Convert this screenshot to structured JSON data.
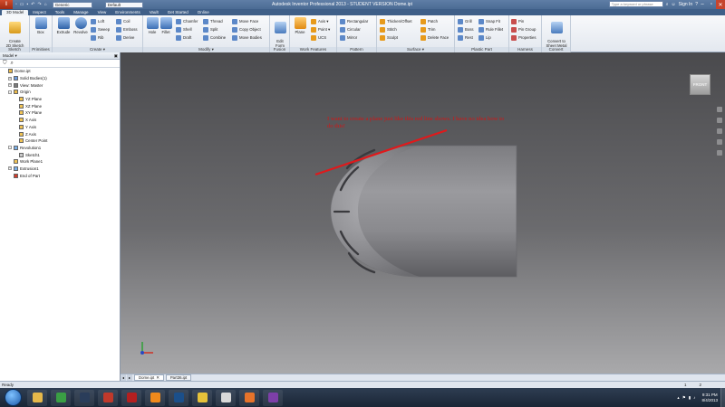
{
  "titlebar": {
    "app_menu": "I",
    "tab_label": "3D Model",
    "material_combo": "Generic",
    "appearance_combo": "Default",
    "title": "Autodesk Inventor Professional 2013 - STUDENT VERSION    Dome.ipt",
    "search_placeholder": "Type a keyword or phrase",
    "sign_in": "Sign In"
  },
  "ribbon_tabs": [
    "3D Model",
    "Inspect",
    "Tools",
    "Manage",
    "View",
    "Environments",
    "Vault",
    "Get Started",
    "Online"
  ],
  "ribbon": {
    "sketch": {
      "label": "Sketch",
      "create_2d": "Create\n2D Sketch"
    },
    "primitives": {
      "label": "Primitives",
      "box": "Box"
    },
    "create": {
      "label": "Create ▾",
      "extrude": "Extrude",
      "revolve": "Revolve",
      "loft": "Loft",
      "sweep": "Sweep",
      "rib": "Rib",
      "coil": "Coil",
      "emboss": "Emboss",
      "derive": "Derive"
    },
    "modify": {
      "label": "Modify ▾",
      "hole": "Hole",
      "fillet": "Fillet",
      "chamfer": "Chamfer",
      "shell": "Shell",
      "draft": "Draft",
      "thread": "Thread",
      "split": "Split",
      "combine": "Combine",
      "move_face": "Move Face",
      "copy_object": "Copy Object",
      "move_bodies": "Move Bodies"
    },
    "fusion": {
      "label": "Fusion",
      "edit_form": "Edit\nForm"
    },
    "work_features": {
      "label": "Work Features",
      "plane": "Plane",
      "axis": "Axis ▾",
      "point": "Point ▾",
      "ucs": "UCS"
    },
    "pattern": {
      "label": "Pattern",
      "rectangular": "Rectangular",
      "circular": "Circular",
      "mirror": "Mirror"
    },
    "surface": {
      "label": "Surface ▾",
      "thicken": "Thicken/Offset",
      "stitch": "Stitch",
      "sculpt": "Sculpt",
      "patch": "Patch",
      "trim": "Trim",
      "delete_face": "Delete Face"
    },
    "plastic_part": {
      "label": "Plastic Part",
      "grill": "Grill",
      "boss": "Boss",
      "rest": "Rest",
      "snap_fit": "Snap Fit",
      "rule_fillet": "Rule Fillet",
      "lip": "Lip"
    },
    "harness": {
      "label": "Harness",
      "pin": "Pin",
      "pin_group": "Pin Group",
      "properties": "Properties"
    },
    "convert": {
      "label": "Convert",
      "sheet_metal": "Convert to\nSheet Metal"
    }
  },
  "browser": {
    "header": "Model ▾",
    "tree": [
      {
        "label": "Dome.ipt",
        "depth": 0,
        "exp": ""
      },
      {
        "label": "Solid Bodies(1)",
        "depth": 1,
        "exp": "+"
      },
      {
        "label": "View: Master",
        "depth": 1,
        "exp": "+"
      },
      {
        "label": "Origin",
        "depth": 1,
        "exp": "-"
      },
      {
        "label": "YZ Plane",
        "depth": 2,
        "exp": ""
      },
      {
        "label": "XZ Plane",
        "depth": 2,
        "exp": ""
      },
      {
        "label": "XY Plane",
        "depth": 2,
        "exp": ""
      },
      {
        "label": "X Axis",
        "depth": 2,
        "exp": ""
      },
      {
        "label": "Y Axis",
        "depth": 2,
        "exp": ""
      },
      {
        "label": "Z Axis",
        "depth": 2,
        "exp": ""
      },
      {
        "label": "Center Point",
        "depth": 2,
        "exp": ""
      },
      {
        "label": "Revolution1",
        "depth": 1,
        "exp": "-"
      },
      {
        "label": "Sketch1",
        "depth": 2,
        "exp": ""
      },
      {
        "label": "Work Plane1",
        "depth": 1,
        "exp": ""
      },
      {
        "label": "Extrusion1",
        "depth": 1,
        "exp": "+"
      },
      {
        "label": "End of Part",
        "depth": 1,
        "exp": ""
      }
    ]
  },
  "viewport": {
    "viewcube_label": "FRONT",
    "annotation": "I want to create a plane just like this red line shows.  I have no idea how to do this!",
    "colors": {
      "annotation": "#d21616",
      "part": "#8c8c90"
    }
  },
  "doc_tabs": [
    "Dome.ipt",
    "Part36.ipt"
  ],
  "status": {
    "text": "Ready",
    "page": "1",
    "count": "2"
  },
  "taskbar": {
    "apps": [
      "explorer-icon",
      "chrome-icon",
      "steam-icon",
      "word-icon",
      "inventor-icon",
      "vlc-icon",
      "photoshop-icon",
      "sumatra-icon",
      "cc-icon",
      "origin-icon",
      "onenote-icon"
    ],
    "time": "9:31 PM",
    "date": "8/4/2013"
  }
}
